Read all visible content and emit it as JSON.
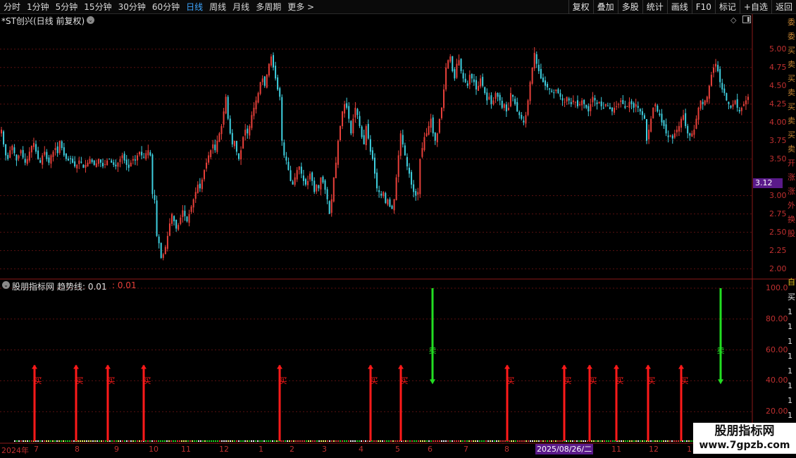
{
  "toolbar": {
    "periods": [
      "分时",
      "1分钟",
      "5分钟",
      "15分钟",
      "30分钟",
      "60分钟",
      "日线",
      "周线",
      "月线",
      "多周期",
      "更多 >"
    ],
    "active_period": "日线",
    "buttons": [
      "复权",
      "叠加",
      "多股",
      "统计",
      "画线",
      "F10",
      "标记",
      "+自选",
      "返回"
    ]
  },
  "stock": {
    "title": "*ST创兴(日线 前复权)",
    "dropdown_glyph": "⌄",
    "last_price": "3.12",
    "price_axis": [
      "5.00",
      "4.75",
      "4.50",
      "4.25",
      "4.00",
      "3.75",
      "3.50",
      "3.00",
      "2.75",
      "2.50",
      "2.25",
      "2.00"
    ]
  },
  "indicator": {
    "name": "股朋指标网",
    "trend_label": "趋势线: 0.01",
    "value2": ": 0.01",
    "axis": [
      "100.0",
      "80.00",
      "60.00",
      "40.00",
      "20.00"
    ],
    "buy_label": "买",
    "sell_label": "卖"
  },
  "signals": {
    "buy_dates": [
      "2024-07",
      "2024-08",
      "2024-09a",
      "2024-10",
      "2025-02",
      "2025-04",
      "2025-05",
      "2025-08",
      "2025-09",
      "2025-10a",
      "2025-11",
      "2025-12",
      "2026-01"
    ],
    "sell_dates": [
      "2025-06",
      "2026-02"
    ]
  },
  "x_axis": {
    "year_label": "2024年",
    "months": [
      "7",
      "8",
      "9",
      "10",
      "11",
      "12",
      "1",
      "2",
      "3",
      "4",
      "5",
      "6",
      "7",
      "8",
      "11",
      "12",
      "1"
    ],
    "cursor_date": "2025/08/26/二"
  },
  "right_strip": [
    "委",
    "委",
    "买",
    "卖",
    "买",
    "卖",
    "买",
    "卖",
    "买",
    "卖",
    "开",
    "涨",
    "涨",
    "外",
    "换",
    "股",
    "",
    "",
    "",
    "",
    "自",
    "买",
    "1",
    "1",
    "1",
    "1",
    "1",
    "1",
    "1",
    "1"
  ],
  "watermark": {
    "title": "股朋指标网",
    "url": "www.7gpzb.com"
  },
  "colors": {
    "up": "#e8403a",
    "down": "#3fd0e0",
    "buy": "#ff1a1a",
    "sell": "#22dd22",
    "accent": "#3ea6ff",
    "cursor_bg": "#5a1a8a"
  },
  "chart_data": {
    "type": "candlestick",
    "price_ylim": [
      1.9,
      5.45
    ],
    "indicator_ylim": [
      0,
      105
    ],
    "closes": [
      3.9,
      3.7,
      3.55,
      3.5,
      3.62,
      3.68,
      3.58,
      3.48,
      3.55,
      3.62,
      3.52,
      3.45,
      3.5,
      3.6,
      3.68,
      3.72,
      3.6,
      3.5,
      3.45,
      3.55,
      3.6,
      3.5,
      3.45,
      3.55,
      3.6,
      3.65,
      3.58,
      3.75,
      3.65,
      3.55,
      3.5,
      3.48,
      3.5,
      3.45,
      3.4,
      3.42,
      3.48,
      3.45,
      3.38,
      3.42,
      3.45,
      3.5,
      3.46,
      3.42,
      3.44,
      3.5,
      3.45,
      3.4,
      3.43,
      3.48,
      3.5,
      3.45,
      3.42,
      3.4,
      3.45,
      3.5,
      3.55,
      3.48,
      3.42,
      3.38,
      3.45,
      3.5,
      3.48,
      3.55,
      3.6,
      3.55,
      3.52,
      3.58,
      3.62,
      3.55,
      3.02,
      2.94,
      2.45,
      2.35,
      2.15,
      2.2,
      2.3,
      2.45,
      2.62,
      2.75,
      2.65,
      2.55,
      2.6,
      2.7,
      2.8,
      2.72,
      2.65,
      2.75,
      2.85,
      2.95,
      3.05,
      3.15,
      3.1,
      3.22,
      3.35,
      3.45,
      3.55,
      3.62,
      3.7,
      3.62,
      3.75,
      3.85,
      3.95,
      4.15,
      4.35,
      4.05,
      3.85,
      3.7,
      3.75,
      3.6,
      3.5,
      3.62,
      3.8,
      3.9,
      3.85,
      3.95,
      4.1,
      4.2,
      4.3,
      4.4,
      4.55,
      4.6,
      4.5,
      4.65,
      4.8,
      4.9,
      4.75,
      4.6,
      4.45,
      4.35,
      3.75,
      3.55,
      3.48,
      3.35,
      3.2,
      3.15,
      3.25,
      3.35,
      3.4,
      3.3,
      3.2,
      3.15,
      3.2,
      3.3,
      3.2,
      3.05,
      3.15,
      3.1,
      3.25,
      3.18,
      3.08,
      2.95,
      2.75,
      2.95,
      3.25,
      3.45,
      3.75,
      3.95,
      4.15,
      4.25,
      4.2,
      4.05,
      3.85,
      4.05,
      4.2,
      4.1,
      3.95,
      3.8,
      3.7,
      3.95,
      3.78,
      3.6,
      3.5,
      3.3,
      3.1,
      3.05,
      3.0,
      3.05,
      2.9,
      2.95,
      2.85,
      2.82,
      2.95,
      3.25,
      3.55,
      3.85,
      3.7,
      3.55,
      3.4,
      3.3,
      3.15,
      3.05,
      3.0,
      3.05,
      3.5,
      3.65,
      3.8,
      3.85,
      3.95,
      4.05,
      3.85,
      3.75,
      3.85,
      4.05,
      4.2,
      4.45,
      4.75,
      4.85,
      4.9,
      4.7,
      4.6,
      4.8,
      4.85,
      4.7,
      4.6,
      4.55,
      4.5,
      4.65,
      4.6,
      4.55,
      4.45,
      4.5,
      4.6,
      4.5,
      4.4,
      4.3,
      4.35,
      4.25,
      4.3,
      4.4,
      4.35,
      4.3,
      4.2,
      4.25,
      4.15,
      4.2,
      4.4,
      4.35,
      4.25,
      4.15,
      4.1,
      4.05,
      4.0,
      4.1,
      4.3,
      4.55,
      4.75,
      4.95,
      4.8,
      4.7,
      4.6,
      4.55,
      4.5,
      4.48,
      4.45,
      4.42,
      4.4,
      4.45,
      4.4,
      4.35,
      4.3,
      4.28,
      4.35,
      4.3,
      4.25,
      4.3,
      4.28,
      4.22,
      4.25,
      4.3,
      4.25,
      4.2,
      4.15,
      4.25,
      4.35,
      4.3,
      4.25,
      4.28,
      4.22,
      4.2,
      4.25,
      4.22,
      4.18,
      4.15,
      4.2,
      4.22,
      4.25,
      4.3,
      4.25,
      4.2,
      4.22,
      4.28,
      4.25,
      4.2,
      4.25,
      4.2,
      4.15,
      4.1,
      4.05,
      3.75,
      3.9,
      4.05,
      4.2,
      4.25,
      4.15,
      4.1,
      4.0,
      3.95,
      3.85,
      3.8,
      3.82,
      3.78,
      3.85,
      3.9,
      3.95,
      4.05,
      4.1,
      3.95,
      3.85,
      3.82,
      3.85,
      3.9,
      4.05,
      4.2,
      4.3,
      4.25,
      4.3,
      4.35,
      4.5,
      4.65,
      4.75,
      4.8,
      4.7,
      4.55,
      4.45,
      4.4,
      4.3,
      4.25,
      4.2,
      4.25,
      4.3,
      4.2,
      4.15,
      4.2,
      4.25,
      4.3,
      4.35
    ],
    "buy_levels": [
      50,
      50,
      50,
      50,
      50,
      50,
      50,
      50,
      50,
      50,
      50,
      50,
      50
    ],
    "sell_levels": [
      100,
      100
    ]
  }
}
